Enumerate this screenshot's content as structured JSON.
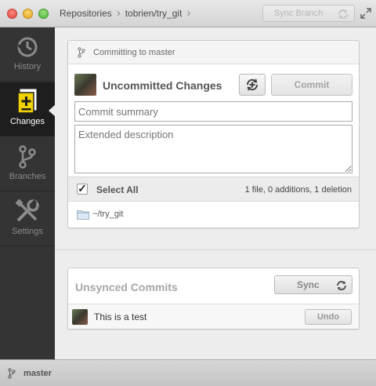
{
  "titlebar": {
    "breadcrumbs": [
      "Repositories",
      "tobrien/try_git"
    ],
    "sync_branch_label": "Sync Branch"
  },
  "sidebar": {
    "items": [
      {
        "label": "History",
        "icon": "history-icon",
        "active": false
      },
      {
        "label": "Changes",
        "icon": "changes-icon",
        "active": true
      },
      {
        "label": "Branches",
        "icon": "branches-icon",
        "active": false
      },
      {
        "label": "Settings",
        "icon": "settings-icon",
        "active": false
      }
    ]
  },
  "commit_panel": {
    "header": "Committing to master",
    "title": "Uncommitted Changes",
    "commit_label": "Commit",
    "summary_placeholder": "Commit summary",
    "description_placeholder": "Extended description",
    "select_all_label": "Select All",
    "stats": "1 file, 0 additions, 1 deletion",
    "path": "~/try_git"
  },
  "unsynced": {
    "title": "Unsynced Commits",
    "sync_label": "Sync",
    "commits": [
      {
        "message": "This is a test",
        "undo_label": "Undo"
      }
    ]
  },
  "statusbar": {
    "branch": "master"
  },
  "colors": {
    "sidebar_bg": "#343434",
    "sidebar_active_bg": "#1e1e1e",
    "main_bg": "#ededed",
    "changes_icon_accent": "#f0d000"
  }
}
